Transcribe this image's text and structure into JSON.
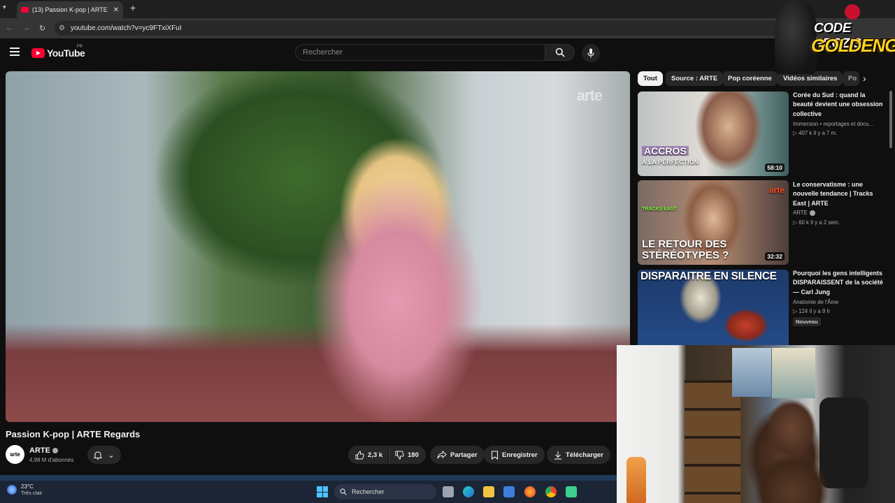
{
  "browser": {
    "tab_title": "(13) Passion K-pop | ARTE Rega",
    "url": "youtube.com/watch?v=yc9FTxiXFuI"
  },
  "youtube": {
    "logo_text": "YouTube",
    "region": "FR",
    "search_placeholder": "Rechercher"
  },
  "video": {
    "watermark": "arte",
    "title": "Passion K-pop | ARTE Regards",
    "channel": "ARTE",
    "channel_avatar_text": "arte",
    "subscribers": "4,98 M d'abonnés",
    "likes": "2,3 k",
    "dislikes": "180",
    "share_label": "Partager",
    "save_label": "Enregistrer",
    "download_label": "Télécharger"
  },
  "chips": [
    "Tout",
    "Source : ARTE",
    "Pop coréenne",
    "Vidéos similaires",
    "Po"
  ],
  "recommendations": [
    {
      "title": "Corée du Sud : quand la beauté devient une obsession collective",
      "channel": "Immersion • reportages et docu...",
      "meta": "▷ 407 k   Il y a 7 m.",
      "duration": "58:10",
      "overlay_line1": "ACCROS",
      "overlay_line2": "À LA PERFECTION"
    },
    {
      "title": "Le conservatisme : une nouvelle tendance | Tracks East | ARTE",
      "channel": "ARTE",
      "meta": "▷ 60 k   Il y a 2 sem.",
      "duration": "32:32",
      "overlay_line1": "LE RETOUR DES",
      "overlay_line2": "STÉRÉOTYPES ?",
      "overlay_small": "TRACKS EAST",
      "overlay_brand": "arte"
    },
    {
      "title": "Pourquoi les gens intelligents DISPARAISSENT de la société — Carl Jung",
      "channel": "Anatomie de l'Âme",
      "meta": "▷ 124   Il y a 9 h",
      "badge": "Nouveau",
      "overlay_line1": "DISPARAITRE EN SILENCE"
    }
  ],
  "taskbar": {
    "temperature": "23°C",
    "weather": "Très clair",
    "search_label": "Rechercher"
  },
  "stream_overlay": {
    "line1": "CODE PROZIS",
    "line2": "GOLDENG"
  },
  "colors": {
    "yt_red": "#ff0033",
    "bg": "#0f0f0f",
    "pill": "#272727",
    "overlay_gold": "#ffd21f"
  }
}
